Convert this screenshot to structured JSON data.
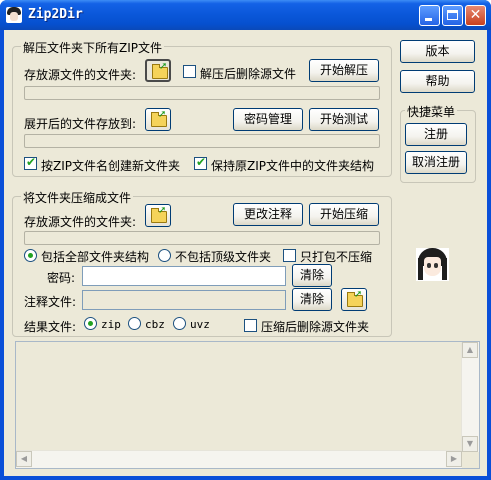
{
  "window": {
    "title": "Zip2Dir"
  },
  "extract_group": {
    "legend": "解压文件夹下所有ZIP文件",
    "source_folder_label": "存放源文件的文件夹:",
    "delete_after_extract_label": "解压后删除源文件",
    "start_extract_label": "开始解压",
    "target_folder_label": "展开后的文件存放到:",
    "password_manage_label": "密码管理",
    "start_test_label": "开始测试",
    "create_folder_by_name_label": "按ZIP文件名创建新文件夹",
    "create_folder_by_name_checked": true,
    "keep_structure_label": "保持原ZIP文件中的文件夹结构",
    "keep_structure_checked": true,
    "delete_after_extract_checked": false
  },
  "compress_group": {
    "legend": "将文件夹压缩成文件",
    "source_folder_label": "存放源文件的文件夹:",
    "change_comment_label": "更改注释",
    "start_compress_label": "开始压缩",
    "include_all_label": "包括全部文件夹结构",
    "exclude_top_label": "不包括顶级文件夹",
    "selected_structure": "include_all",
    "pack_only_label": "只打包不压缩",
    "pack_only_checked": false,
    "password_label": "密码:",
    "password_value": "",
    "clear1_label": "清除",
    "comment_file_label": "注释文件:",
    "comment_file_value": "",
    "clear2_label": "清除",
    "result_file_label": "结果文件:",
    "formats": [
      "zip",
      "cbz",
      "uvz"
    ],
    "selected_format": "zip",
    "delete_after_compress_label": "压缩后删除源文件夹",
    "delete_after_compress_checked": false
  },
  "side_panel": {
    "version_label": "版本",
    "help_label": "帮助",
    "quick_menu_legend": "快捷菜单",
    "register_label": "注册",
    "unregister_label": "取消注册"
  },
  "colors": {
    "titlebar": "#0a57d9",
    "dialog_bg": "#ece9d8",
    "check_green": "#21a121",
    "button_border": "#003c74"
  }
}
